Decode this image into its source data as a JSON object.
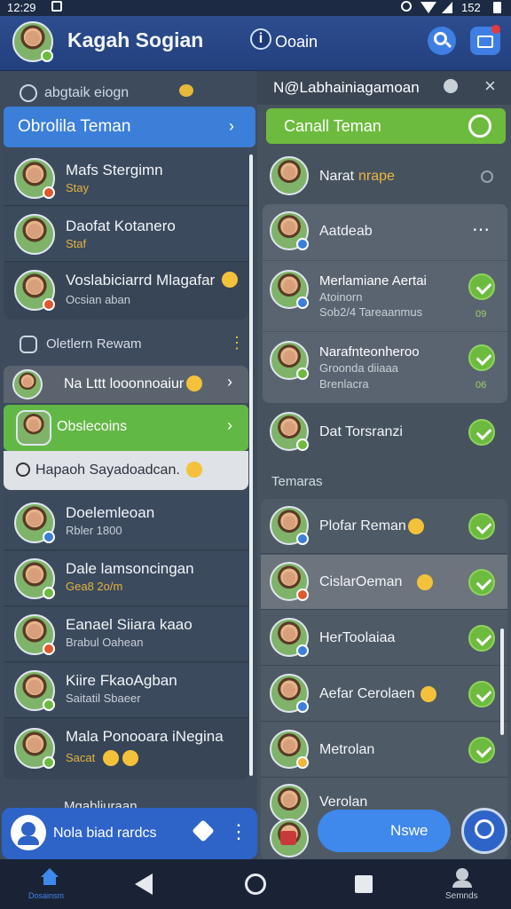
{
  "status_bar": {
    "time": "12:29",
    "battery": "152"
  },
  "header": {
    "title": "Kagah Sogian",
    "center_label": "Ooain",
    "info_glyph": "i"
  },
  "left": {
    "search_placeholder": "abgtaik eiogn",
    "section1_title": "Obrolila Teman",
    "chats": [
      {
        "name": "Mafs Stergimn",
        "sub": "Stay"
      },
      {
        "name": "Daofat Kotanero",
        "sub": "Staf"
      },
      {
        "name": "Voslabiciarrd Mlagafar",
        "sub": "Ocsian aban"
      }
    ],
    "group_header": "Oletlern Rewam",
    "row_label": "Na Lttt looonnoaiur",
    "active_label": "Obslecoins",
    "suggestion": "Hapaoh Sayadoadcan.",
    "contacts": [
      {
        "name": "Doelemleoan",
        "sub": "Rbler 1800"
      },
      {
        "name": "Dale lamsoncingan",
        "sub": "Gea8 2o/m"
      },
      {
        "name": "Eanael Siiara kaao",
        "sub": "Brabul Oahean"
      },
      {
        "name": "Kiire FkaoAgban",
        "sub": "Saitatil Sbaeer"
      },
      {
        "name": "Mala Ponooara iNegina",
        "sub": "Sacat"
      }
    ],
    "partial_name": "Mgabliuraan",
    "bottom_card": "Nola biad rardcs"
  },
  "right": {
    "title": "N@Labhainiagamoan",
    "section1_title": "Canall Teman",
    "items": [
      {
        "name": "Narat",
        "accent": "nrape"
      },
      {
        "name": "Aatdeab",
        "sub1": "",
        "sub2": ""
      },
      {
        "name": "Merlamiane Aertai",
        "sub1": "Atoinorn",
        "sub2": "Sob2/4 Tareaanmus",
        "note": "09"
      },
      {
        "name": "Narafnteonheroo",
        "sub1": "Groonda diiaaa",
        "sub2": "Brenlacra",
        "note": "06"
      },
      {
        "name": "Dat Torsranzi"
      }
    ],
    "section2_label": "Temaras",
    "contacts": [
      {
        "name": "Plofar Reman"
      },
      {
        "name": "CislarOeman"
      },
      {
        "name": "HerToolaiaa"
      },
      {
        "name": "Aefar Cerolaen"
      },
      {
        "name": "Metrolan"
      },
      {
        "name": "Verolan"
      }
    ],
    "fab_label": "Nswe"
  },
  "nav": {
    "home": "Dosainsm",
    "profile": "Semnds"
  },
  "colors": {
    "accent_blue": "#2a6fd6",
    "accent_green": "#6dbb3e",
    "header": "#2d4d8f"
  }
}
